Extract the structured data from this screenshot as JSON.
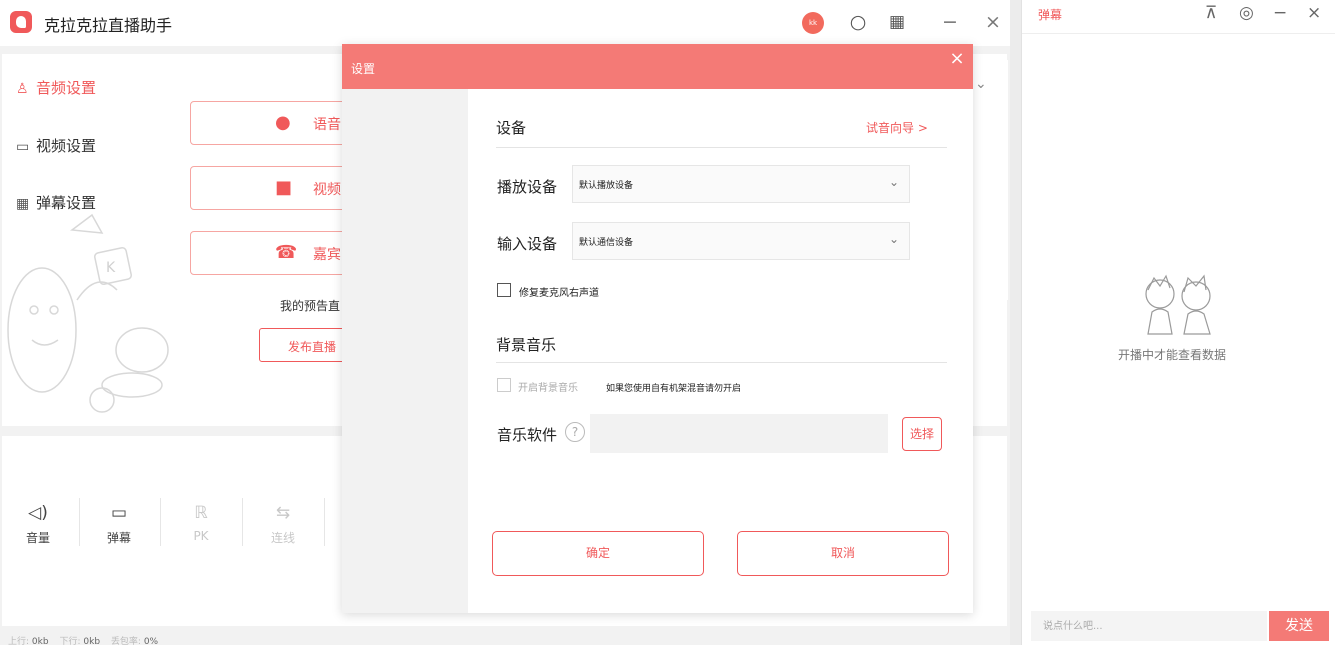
{
  "app": {
    "title": "克拉克拉直播助手",
    "avatar_text": "kk"
  },
  "main": {
    "modes": [
      {
        "label": "语音"
      },
      {
        "label": "视频"
      },
      {
        "label": "嘉宾"
      }
    ],
    "preview_notice": "我的预告直",
    "publish_label": "发布直播",
    "controls": [
      {
        "label": "音量",
        "icon": "volume-icon"
      },
      {
        "label": "弹幕",
        "icon": "danmu-icon"
      },
      {
        "label": "PK",
        "icon": "pk-icon"
      },
      {
        "label": "连线",
        "icon": "link-icon"
      }
    ],
    "status": {
      "upload_label": "上行:",
      "upload_value": "0kb",
      "download_label": "下行:",
      "download_value": "0kb",
      "loss_label": "丢包率:",
      "loss_value": "0%"
    }
  },
  "settings": {
    "title": "设置",
    "nav": [
      {
        "label": "音频设置",
        "icon": "microphone-icon",
        "active": true
      },
      {
        "label": "视频设置",
        "icon": "camera-icon",
        "active": false
      },
      {
        "label": "弹幕设置",
        "icon": "grid-icon",
        "active": false
      }
    ],
    "device_section": "设备",
    "wizard_link": "试音向导 >",
    "playback_label": "播放设备",
    "playback_value": "默认播放设备",
    "input_label": "输入设备",
    "input_value": "默认通信设备",
    "fix_mic_label": "修复麦克风右声道",
    "bgm_section": "背景音乐",
    "bgm_enable_label": "开启背景音乐",
    "bgm_hint": "如果您使用自有机架混音请勿开启",
    "music_software_label": "音乐软件",
    "choose_label": "选择",
    "confirm_label": "确定",
    "cancel_label": "取消"
  },
  "danmu": {
    "title": "弹幕",
    "empty_text": "开播中才能查看数据",
    "input_placeholder": "说点什么吧...",
    "send_label": "发送"
  },
  "colors": {
    "accent": "#f0595a",
    "header": "#f47a76"
  }
}
